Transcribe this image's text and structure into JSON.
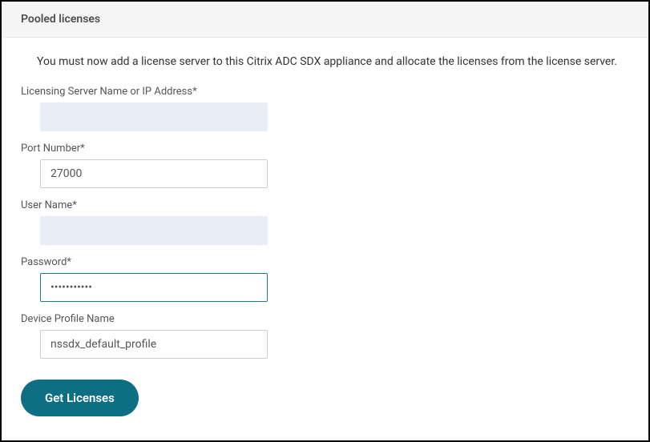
{
  "header": {
    "title": "Pooled licenses"
  },
  "description": "You must now add a license server to this Citrix ADC SDX appliance and allocate the licenses from the license server.",
  "form": {
    "server": {
      "label": "Licensing Server Name or IP Address*",
      "value": ""
    },
    "port": {
      "label": "Port Number*",
      "value": "27000"
    },
    "username": {
      "label": "User Name*",
      "value": ""
    },
    "password": {
      "label": "Password*",
      "value": "•••••••••••"
    },
    "profile": {
      "label": "Device Profile Name",
      "value": "nssdx_default_profile"
    }
  },
  "actions": {
    "get_licenses": "Get Licenses"
  }
}
